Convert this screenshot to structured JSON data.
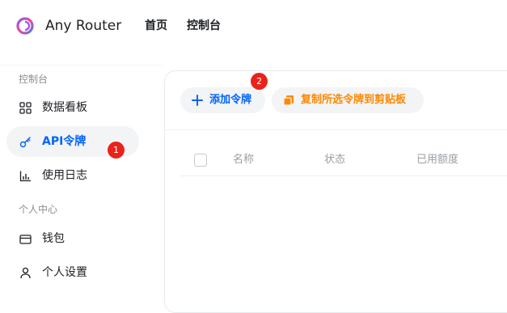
{
  "header": {
    "brand": "Any Router",
    "nav": {
      "home": "首页",
      "console": "控制台"
    }
  },
  "sidebar": {
    "sections": [
      {
        "title": "控制台"
      },
      {
        "title": "个人中心"
      }
    ],
    "items": [
      {
        "label": "数据看板",
        "icon": "dashboard-grid-icon"
      },
      {
        "label": "API令牌",
        "icon": "key-icon",
        "active": true
      },
      {
        "label": "使用日志",
        "icon": "bar-chart-icon"
      },
      {
        "label": "钱包",
        "icon": "wallet-icon"
      },
      {
        "label": "个人设置",
        "icon": "user-icon"
      }
    ]
  },
  "badges": {
    "one": "1",
    "two": "2"
  },
  "toolbar": {
    "add_label": "添加令牌",
    "copy_label": "复制所选令牌到剪贴板"
  },
  "table": {
    "columns": [
      "名称",
      "状态",
      "已用额度"
    ]
  },
  "colors": {
    "accent": "#0064fa",
    "orange": "#ff8800",
    "badge": "#e8231c"
  }
}
